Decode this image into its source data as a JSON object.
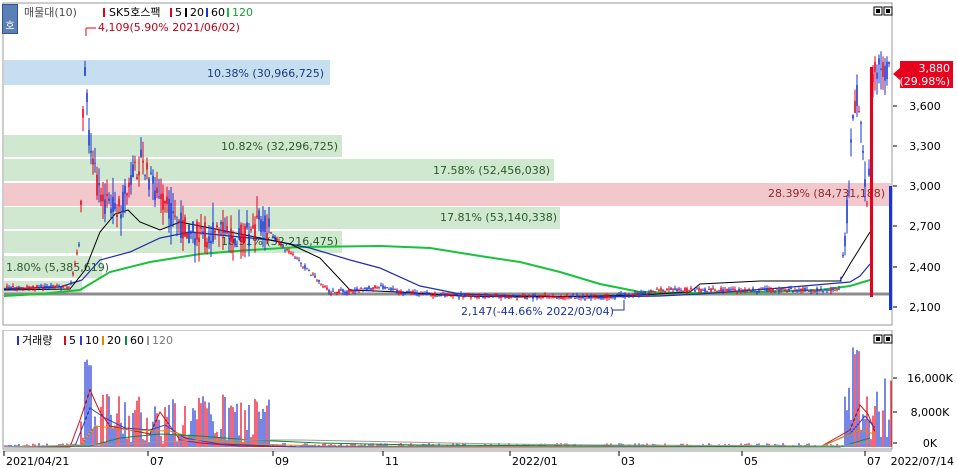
{
  "colors": {
    "up": "#e8001c",
    "down": "#1a35d6",
    "ma5": "#000000",
    "ma20": "#1f2fa8",
    "ma60": "#19c23a",
    "ma120": "#8c8c8c",
    "vma5": "#d01010",
    "vma10": "#3040c8",
    "vma20": "#e08a00",
    "vma60": "#0a8a3a",
    "vma120": "#999999",
    "band_blue": "#c6dff0",
    "band_green": "#cfe8cf",
    "band_red": "#f2c8cc"
  },
  "price_chart": {
    "legend": {
      "title": "매물대(10)",
      "stock": "SK5호스팩",
      "ma5": "5",
      "ma20": "20",
      "ma60": "60",
      "ma120": "120"
    },
    "side_tab": "호",
    "current_price": "3,880",
    "current_change": "(29.98%)",
    "y_ticks": [
      "3,600",
      "3,300",
      "3,000",
      "2,700",
      "2,400",
      "2,100"
    ],
    "annotations": {
      "high": "4,109(5.90% 2021/06/02)",
      "low": "2,147(-44.66% 2022/03/04)"
    },
    "volume_profile": [
      {
        "label": "10.38% (30,966,725)",
        "color": "blue"
      },
      {
        "label": "10.82% (32,296,725)",
        "color": "green"
      },
      {
        "label": "17.58% (52,456,038)",
        "color": "green"
      },
      {
        "label": "28.39% (84,731,188)",
        "color": "red"
      },
      {
        "label": "17.81% (53,140,338)",
        "color": "green"
      },
      {
        "label": "10.91% (32,216,475)",
        "color": "green"
      },
      {
        "label": "1.80% (5,385,619)",
        "color": "green"
      }
    ],
    "window_icon": "maximize-icon"
  },
  "volume_chart": {
    "legend": {
      "title": "거래량",
      "ma5": "5",
      "ma10": "10",
      "ma20": "20",
      "ma60": "60",
      "ma120": "120"
    },
    "y_ticks": [
      "16,000K",
      "8,000K",
      "0K"
    ]
  },
  "x_axis": {
    "labels": [
      "2021/04/21",
      "07",
      "09",
      "11",
      "2022/01",
      "03",
      "05",
      "07",
      "2022/07/14"
    ]
  }
}
